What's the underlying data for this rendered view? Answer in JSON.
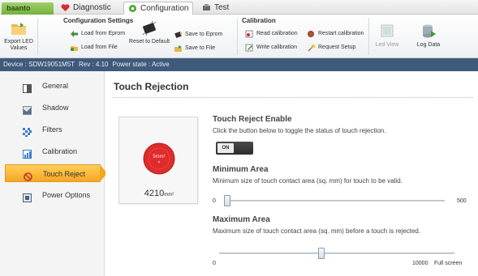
{
  "tabs": {
    "brand": "baanto",
    "diagnostic": "Diagnostic",
    "configuration": "Configuration",
    "test": "Test"
  },
  "ribbon": {
    "export_led": "Export LED Values",
    "config_settings_title": "Configuration Settings",
    "load_from_eprom": "Load from Eprom",
    "load_from_file": "Load from File",
    "reset_to_default": "Reset to Default",
    "save_to_eprom": "Save to Eprom",
    "save_to_file": "Save to File",
    "calibration_title": "Calibration",
    "read_calibration": "Read calibration",
    "write_calibration": "Write calibration",
    "restart_calibration": "Restart calibration",
    "request_setup": "Request Setup",
    "led_view": "Led View",
    "log_data": "Log Data"
  },
  "device_bar": {
    "device": "Device : SDW19051M5T",
    "rev": "Rev : 4.10",
    "power_state": "Power state : Active"
  },
  "sidebar": {
    "items": [
      {
        "label": "General"
      },
      {
        "label": "Shadow"
      },
      {
        "label": "Filters"
      },
      {
        "label": "Calibration"
      },
      {
        "label": "Touch Reject"
      },
      {
        "label": "Power Options"
      }
    ]
  },
  "main": {
    "title": "Touch Rejection",
    "touch_card": {
      "circle_label": "5mm²",
      "value": "4210",
      "unit": "mm²"
    },
    "touch_reject_enable": {
      "title": "Touch Reject Enable",
      "description": "Click the button below to toggle the status of touch rejection.",
      "toggle_label": "ON"
    },
    "minimum_area": {
      "title": "Minimum Area",
      "description": "Minimum size of touch contact area (sq. mm) for touch to be valid.",
      "min_label": "0",
      "max_label": "500",
      "value_fraction": 0.0
    },
    "maximum_area": {
      "title": "Maximum Area",
      "description": "Maximum size of touch contact area (sq. mm) before a touch is rejected.",
      "min_label": "0",
      "max_label": "10000",
      "full_screen_label": "Full screen",
      "value_fraction": 0.42
    }
  },
  "colors": {
    "accent": "#f5a623",
    "device_bar": "#3f5a7b",
    "brand": "#74b13e",
    "touch_circle": "#e02b2b"
  }
}
